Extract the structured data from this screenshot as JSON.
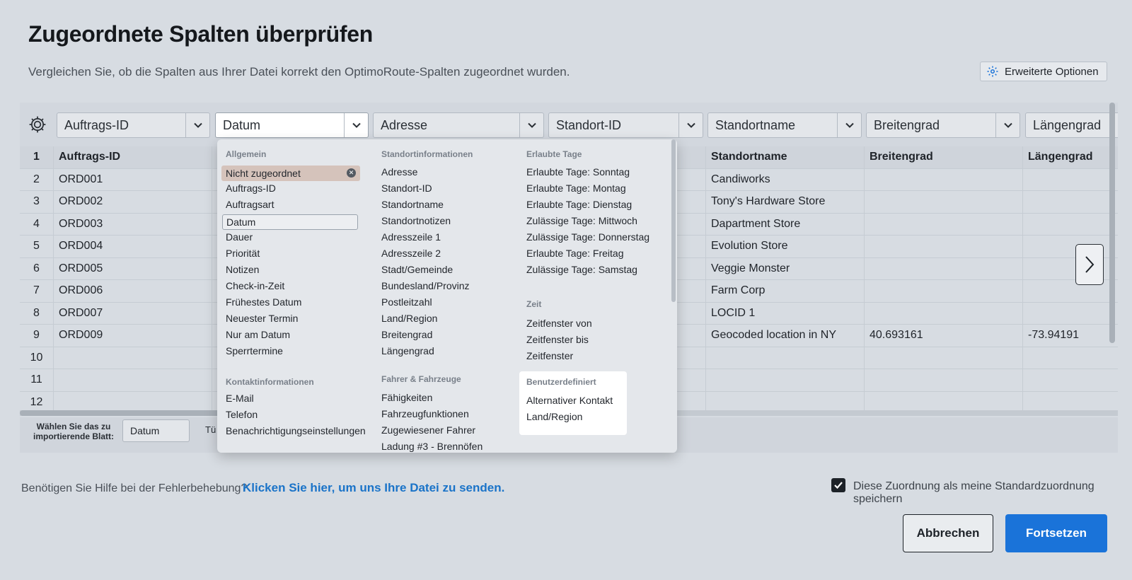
{
  "title": "Zugeordnete Spalten überprüfen",
  "subtitle": "Vergleichen Sie, ob die Spalten aus Ihrer Datei korrekt den OptimoRoute-Spalten zugeordnet wurden.",
  "advanced_button": "Erweiterte Optionen",
  "column_selects": [
    "Auftrags-ID",
    "Datum",
    "Adresse",
    "Standort-ID",
    "Standortname",
    "Breitengrad",
    "Längengrad"
  ],
  "header_row": {
    "num": "1",
    "cells": [
      "Auftrags-ID",
      "",
      "",
      "",
      "Standortname",
      "Breitengrad",
      "Längengrad"
    ]
  },
  "rows": [
    {
      "num": "2",
      "cells": [
        "ORD001",
        "",
        "",
        "",
        "Candiworks",
        "",
        ""
      ]
    },
    {
      "num": "3",
      "cells": [
        "ORD002",
        "",
        "",
        "",
        "Tony's Hardware Store",
        "",
        ""
      ]
    },
    {
      "num": "4",
      "cells": [
        "ORD003",
        "",
        "",
        "",
        "Dapartment Store",
        "",
        ""
      ]
    },
    {
      "num": "5",
      "cells": [
        "ORD004",
        "",
        "",
        "",
        "Evolution Store",
        "",
        ""
      ]
    },
    {
      "num": "6",
      "cells": [
        "ORD005",
        "",
        "",
        "",
        "Veggie Monster",
        "",
        ""
      ]
    },
    {
      "num": "7",
      "cells": [
        "ORD006",
        "",
        "",
        "",
        "Farm Corp",
        "",
        ""
      ]
    },
    {
      "num": "8",
      "cells": [
        "ORD007",
        "",
        "",
        "",
        "LOCID 1",
        "",
        ""
      ]
    },
    {
      "num": "9",
      "cells": [
        "ORD009",
        "",
        "",
        "",
        "Geocoded location in NY",
        "40.693161",
        "-73.94191"
      ]
    },
    {
      "num": "10",
      "cells": [
        "",
        "",
        "",
        "",
        "",
        "",
        ""
      ]
    },
    {
      "num": "11",
      "cells": [
        "",
        "",
        "",
        "",
        "",
        "",
        ""
      ]
    },
    {
      "num": "12",
      "cells": [
        "",
        "",
        "",
        "",
        "",
        "",
        ""
      ]
    }
  ],
  "sheet": {
    "label": "Wählen Sie das zu importierende Blatt:",
    "value": "Datum",
    "cut_label": "Tü"
  },
  "dropdown": {
    "col1": {
      "group1": "Allgemein",
      "items1": [
        "Nicht zugeordnet",
        "Auftrags-ID",
        "Auftragsart",
        "Datum",
        "Dauer",
        "Priorität",
        "Notizen",
        "Check-in-Zeit",
        "Frühestes Datum",
        "Neuester Termin",
        "Nur am Datum",
        "Sperrtermine"
      ],
      "group2": "Kontaktinformationen",
      "items2": [
        "E-Mail",
        "Telefon",
        "Benachrichtigungseinstellungen"
      ]
    },
    "col2": {
      "group1": "Standortinformationen",
      "items1": [
        "Adresse",
        "Standort-ID",
        "Standortname",
        "Standortnotizen",
        "Adresszeile 1",
        "Adresszeile 2",
        "Stadt/Gemeinde",
        "Bundesland/Provinz",
        "Postleitzahl",
        "Land/Region",
        "Breitengrad",
        "Längengrad"
      ],
      "group2": "Fahrer & Fahrzeuge",
      "items2": [
        "Fähigkeiten",
        "Fahrzeugfunktionen",
        "Zugewiesener Fahrer",
        "Ladung #3 - Brennöfen"
      ]
    },
    "col3": {
      "group1": "Erlaubte Tage",
      "items1": [
        "Erlaubte Tage: Sonntag",
        "Erlaubte Tage: Montag",
        "Erlaubte Tage: Dienstag",
        "Zulässige Tage: Mittwoch",
        "Zulässige Tage: Donnerstag",
        "Erlaubte Tage: Freitag",
        "Zulässige Tage: Samstag"
      ],
      "group2": "Zeit",
      "items2": [
        "Zeitfenster von",
        "Zeitfenster bis",
        "Zeitfenster"
      ],
      "group3": "Benutzerdefiniert",
      "items3": [
        "Alternativer Kontakt",
        "Land/Region"
      ]
    }
  },
  "help_text": "Benötigen Sie Hilfe bei der Fehlerbehebung?",
  "help_link": "Klicken Sie hier, um uns Ihre Datei zu senden.",
  "save_default_label": "Diese Zuordnung als meine Standardzuordnung speichern",
  "save_default_checked": true,
  "cancel_label": "Abbrechen",
  "continue_label": "Fortsetzen",
  "colors": {
    "accent": "#1a73d9",
    "link": "#1a73c8",
    "selected_item": "#d5c3bb"
  }
}
